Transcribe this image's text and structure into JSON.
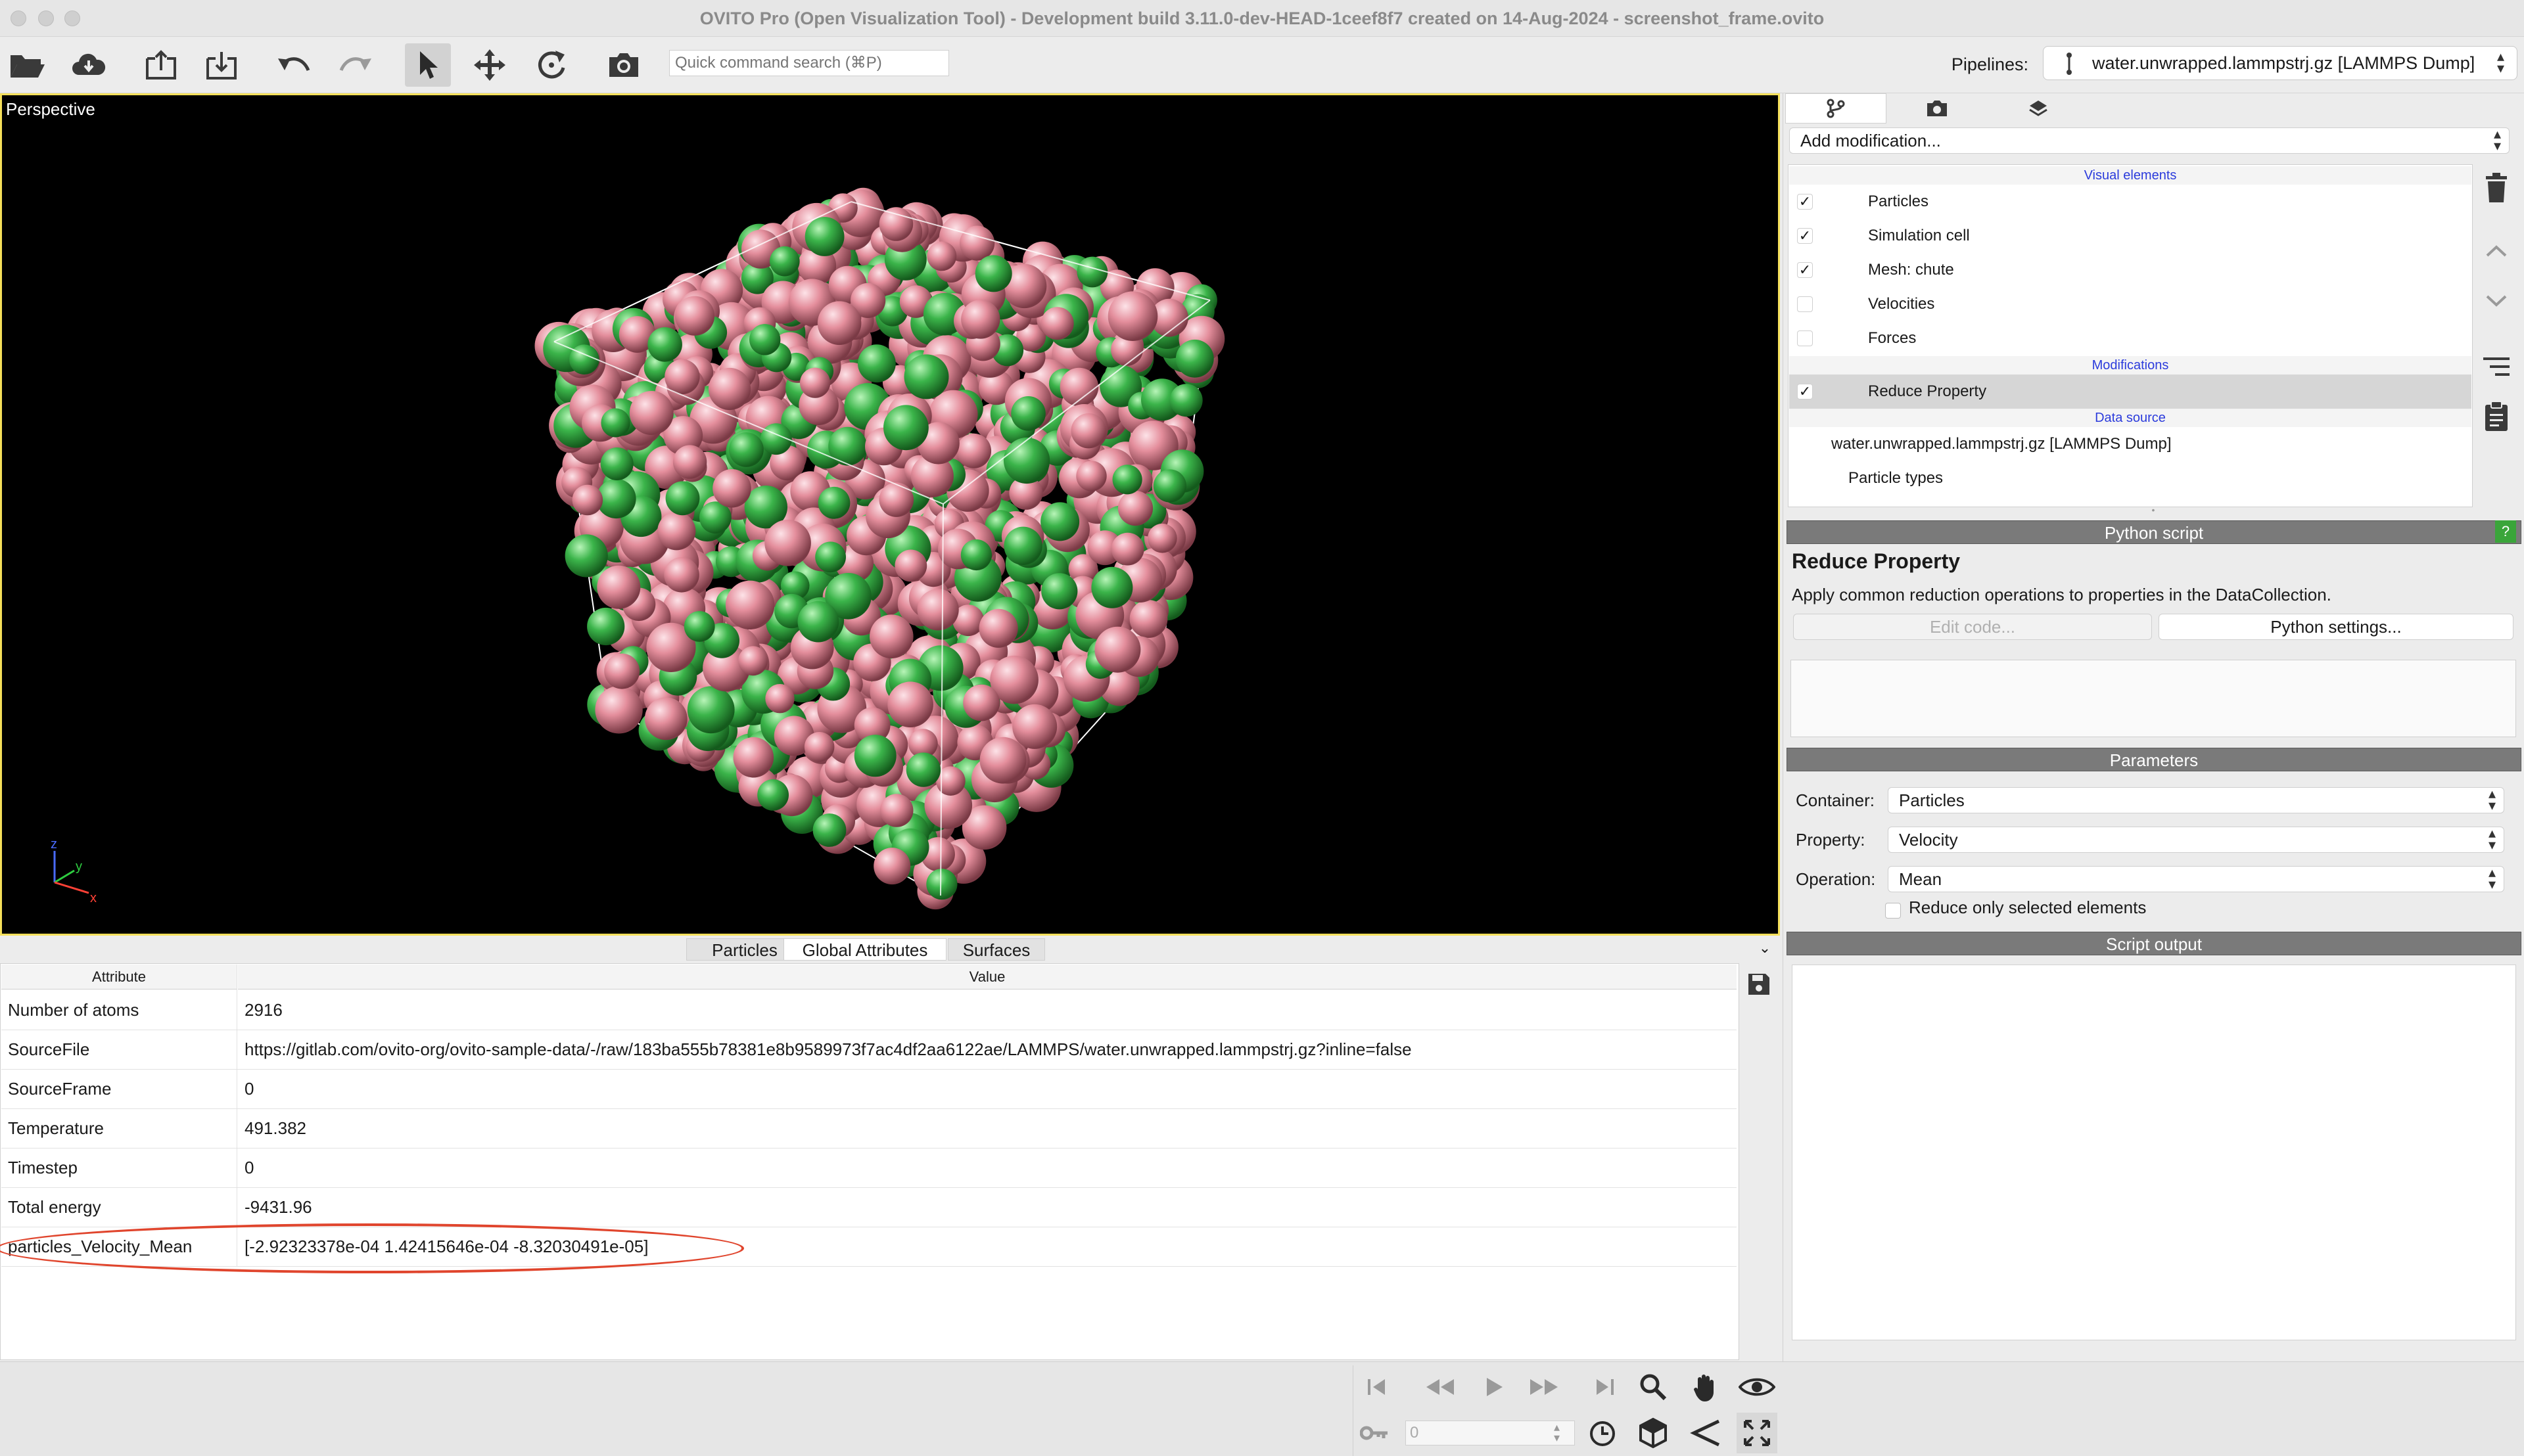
{
  "window": {
    "title": "OVITO Pro (Open Visualization Tool) - Development build 3.11.0-dev-HEAD-1ceef8f7 created on 14-Aug-2024 - screenshot_frame.ovito"
  },
  "toolbar": {
    "search_placeholder": "Quick command search (⌘P)",
    "pipelines_label": "Pipelines:",
    "pipeline_value": "water.unwrapped.lammpstrj.gz [LAMMPS Dump]"
  },
  "viewport": {
    "label": "Perspective",
    "axis_labels": {
      "z": "z",
      "y": "y",
      "x": "x"
    },
    "colors": {
      "particle_pink": "#e48e9c",
      "particle_green": "#3bb44a",
      "cell": "#ffffff",
      "border": "#f5e05a"
    }
  },
  "inspector": {
    "tabs": [
      "Particles",
      "Global Attributes",
      "Surfaces"
    ],
    "active_tab": "Global Attributes",
    "columns": [
      "Attribute",
      "Value"
    ],
    "rows": [
      {
        "attribute": "Number of atoms",
        "value": "2916"
      },
      {
        "attribute": "SourceFile",
        "value": "https://gitlab.com/ovito-org/ovito-sample-data/-/raw/183ba555b78381e8b9589973f7ac4df2aa6122ae/LAMMPS/water.unwrapped.lammpstrj.gz?inline=false"
      },
      {
        "attribute": "SourceFrame",
        "value": "0"
      },
      {
        "attribute": "Temperature",
        "value": "491.382"
      },
      {
        "attribute": "Timestep",
        "value": "0"
      },
      {
        "attribute": "Total energy",
        "value": "-9431.96"
      },
      {
        "attribute": "particles_Velocity_Mean",
        "value": "[-2.92323378e-04  1.42415646e-04 -8.32030491e-05]"
      }
    ],
    "highlight_color": "#e0452d"
  },
  "animation": {
    "frame_value": "0"
  },
  "command_panel": {
    "add_modification": "Add modification...",
    "sections": {
      "visual_elements": "Visual elements",
      "modifications": "Modifications",
      "data_source": "Data source"
    },
    "visual_elements": [
      {
        "label": "Particles",
        "checked": true,
        "mark": "✓"
      },
      {
        "label": "Simulation cell",
        "checked": true,
        "mark": "✓"
      },
      {
        "label": "Mesh: chute",
        "checked": true,
        "mark": "✓"
      },
      {
        "label": "Velocities",
        "checked": false,
        "mark": ""
      },
      {
        "label": "Forces",
        "checked": false,
        "mark": ""
      }
    ],
    "modifications": [
      {
        "label": "Reduce Property",
        "checked": true,
        "mark": "✓"
      }
    ],
    "data_source": {
      "file": "water.unwrapped.lammpstrj.gz [LAMMPS Dump]",
      "sub": "Particle types"
    },
    "python_script_bar": "Python script",
    "help_label": "?",
    "modifier_title": "Reduce Property",
    "modifier_desc": "Apply common reduction operations to properties in the DataCollection.",
    "edit_code": "Edit code...",
    "python_settings": "Python settings...",
    "parameters_bar": "Parameters",
    "params": {
      "container_label": "Container:",
      "container_value": "Particles",
      "property_label": "Property:",
      "property_value": "Velocity",
      "operation_label": "Operation:",
      "operation_value": "Mean",
      "selected_only_label": "Reduce only selected elements"
    },
    "script_output_bar": "Script output"
  }
}
